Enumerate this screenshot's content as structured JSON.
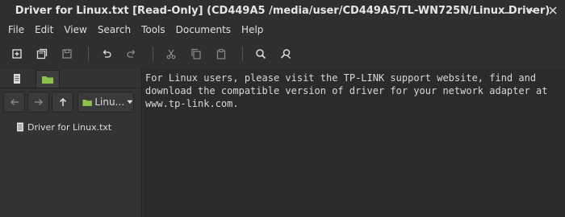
{
  "window": {
    "title": "Driver for Linux.txt [Read-Only] (CD449A5 /media/user/CD449A5/TL-WN725N/Linux Driver)",
    "controls": [
      "minimize-icon",
      "maximize-icon",
      "close-icon"
    ]
  },
  "menu": {
    "items": [
      "File",
      "Edit",
      "View",
      "Search",
      "Tools",
      "Documents",
      "Help"
    ]
  },
  "toolbar": {
    "buttons": [
      "new-document-icon",
      "open-icon",
      "save-icon",
      "undo-icon",
      "redo-icon",
      "cut-icon",
      "copy-icon",
      "paste-icon",
      "find-icon",
      "find-replace-icon"
    ]
  },
  "sidebar": {
    "tabs": [
      "documents-icon",
      "file-browser-icon"
    ],
    "active_tab": "file-browser-icon",
    "location_label": "Linu...",
    "files": [
      "Driver for Linux.txt"
    ]
  },
  "editor": {
    "lines": [
      "For Linux users, please visit the TP-LINK support website, find and",
      "download the compatible version of driver for your network adapter at",
      "www.tp-link.com."
    ]
  },
  "colors": {
    "folder_green": "#8bc34a",
    "background": "#2f2f2f",
    "editor_bg": "#2b2b2b"
  }
}
